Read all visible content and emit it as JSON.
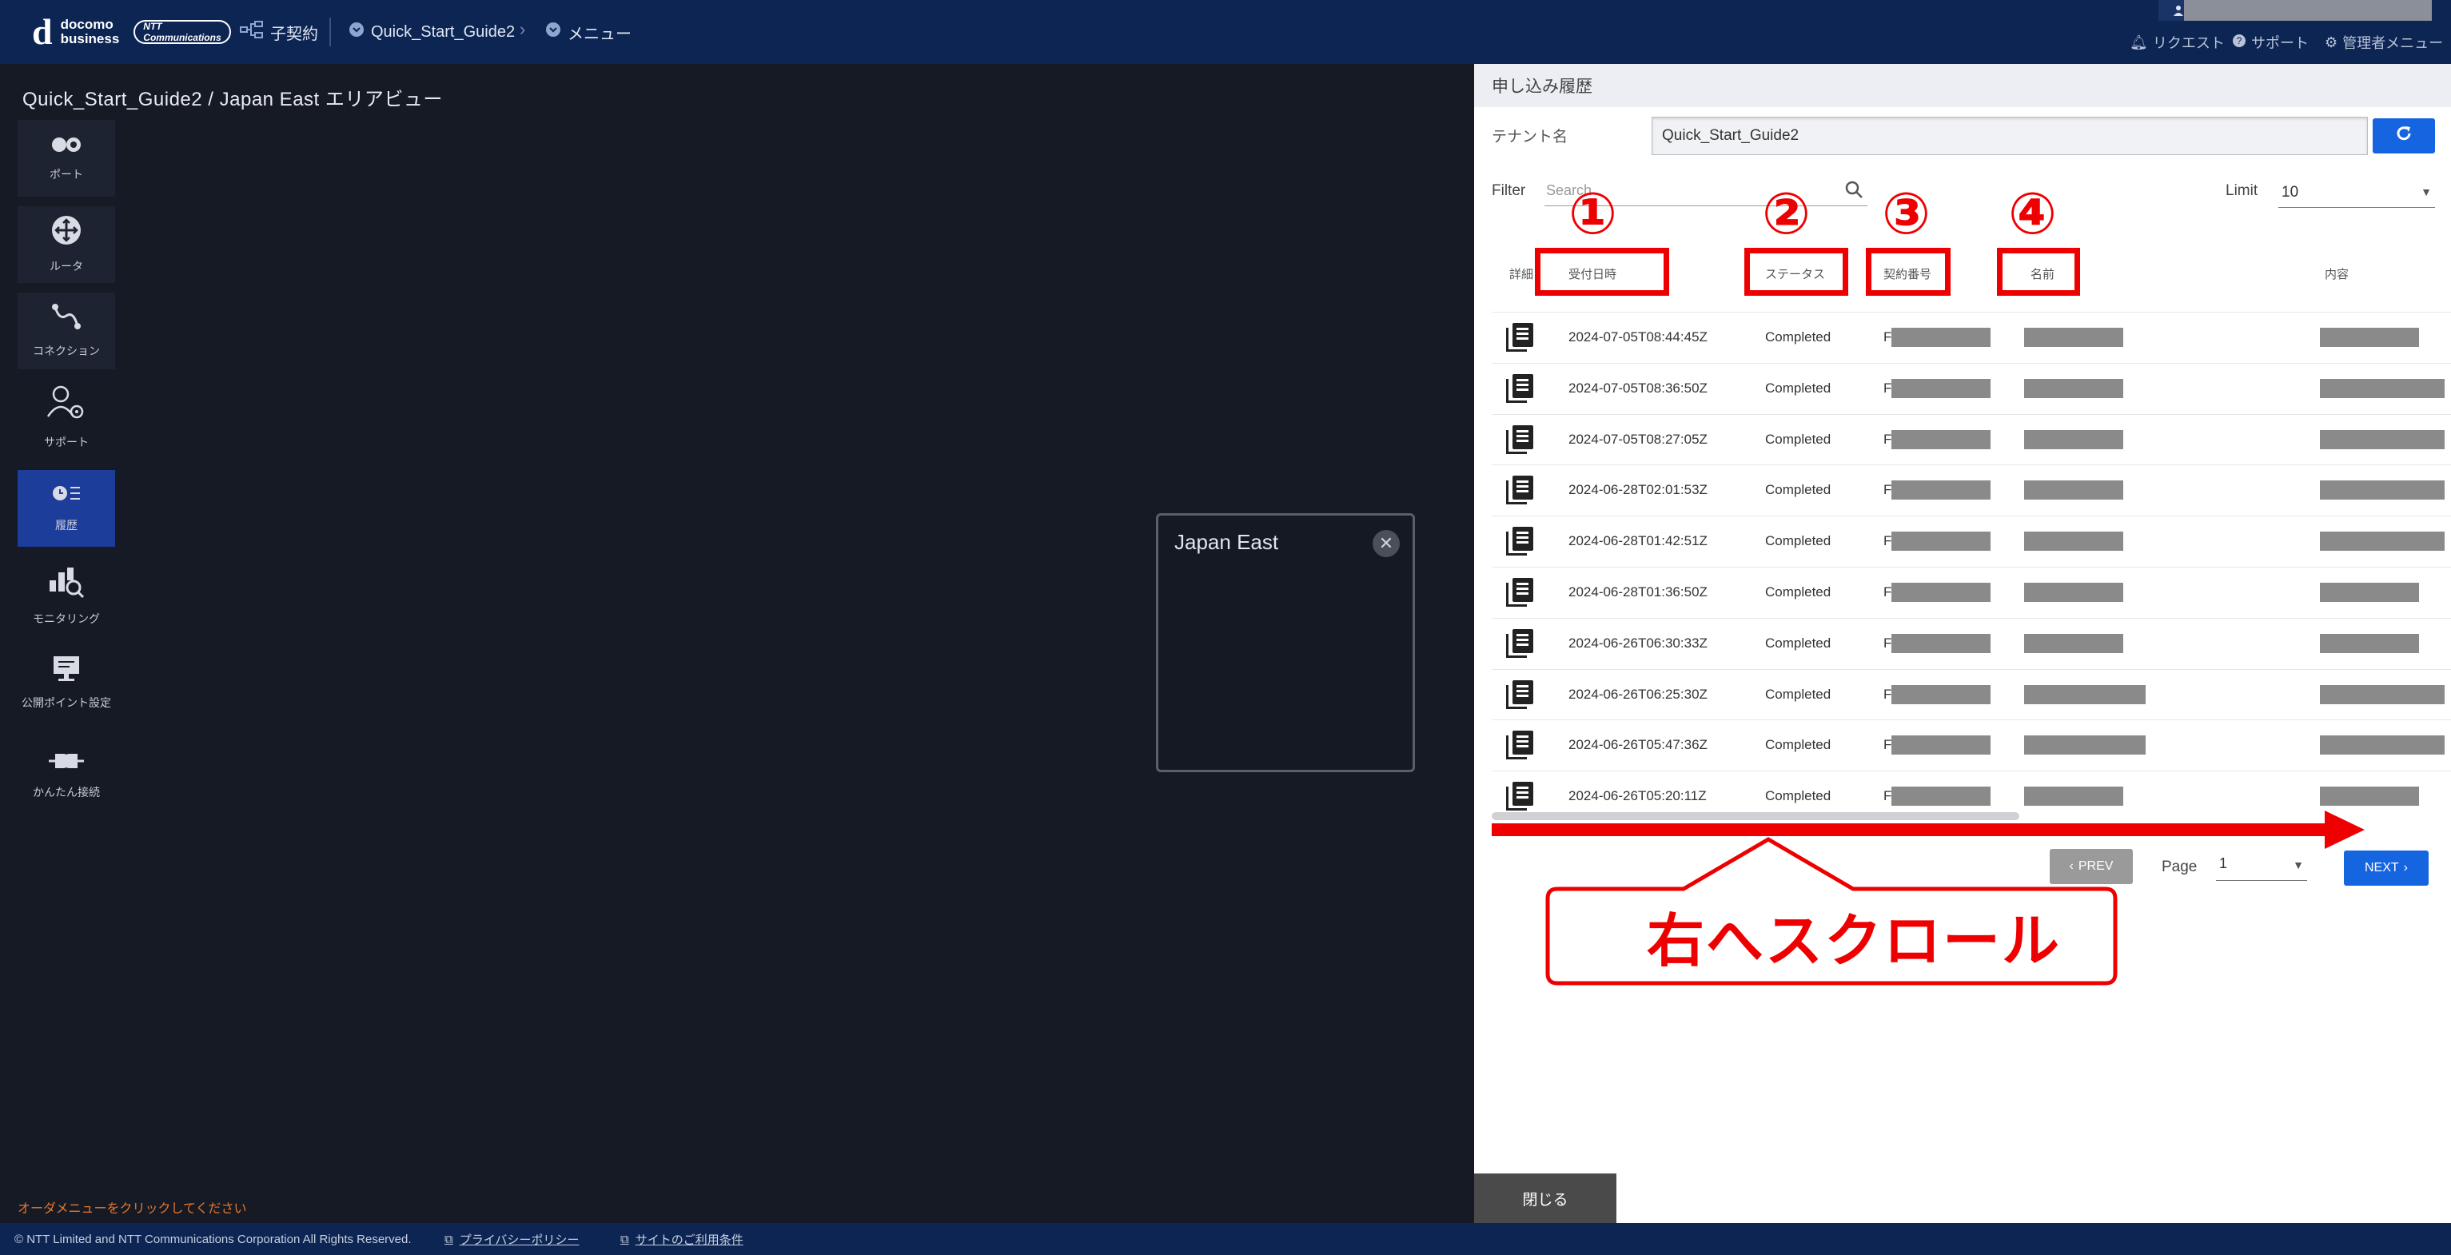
{
  "header": {
    "logo_line1": "docomo",
    "logo_line2": "business",
    "logo_ntt": "NTT Communications",
    "contract_label": "子契約",
    "breadcrumb_1": "Quick_Start_Guide2",
    "breadcrumb_2": "メニュー",
    "request": "リクエスト",
    "support": "サポート",
    "admin_menu": "管理者メニュー"
  },
  "page": {
    "title": "Quick_Start_Guide2 / Japan East エリアビュー",
    "order_hint": "オーダメニューをクリックしてください"
  },
  "sidebar": {
    "items": [
      {
        "label": "ポート",
        "icon": "port-icon"
      },
      {
        "label": "ルータ",
        "icon": "router-icon"
      },
      {
        "label": "コネクション",
        "icon": "connection-icon"
      },
      {
        "label": "サポート",
        "icon": "support-icon"
      },
      {
        "label": "履歴",
        "icon": "history-icon",
        "active": true
      },
      {
        "label": "モニタリング",
        "icon": "monitoring-icon"
      },
      {
        "label": "公開ポイント設定",
        "icon": "public-point-icon"
      },
      {
        "label": "かんたん接続",
        "icon": "easy-connect-icon"
      }
    ]
  },
  "area_popup": {
    "title": "Japan East"
  },
  "panel": {
    "title": "申し込み履歴",
    "tenant_label": "テナント名",
    "tenant_value": "Quick_Start_Guide2",
    "filter_label": "Filter",
    "search_placeholder": "Search",
    "limit_label": "Limit",
    "limit_value": "10",
    "columns": [
      "詳細",
      "受付日時",
      "ステータス",
      "契約番号",
      "名前",
      "内容"
    ],
    "contract_prefix": "F",
    "rows": [
      {
        "date": "2024-07-05T08:44:45Z",
        "status": "Completed"
      },
      {
        "date": "2024-07-05T08:36:50Z",
        "status": "Completed"
      },
      {
        "date": "2024-07-05T08:27:05Z",
        "status": "Completed"
      },
      {
        "date": "2024-06-28T02:01:53Z",
        "status": "Completed"
      },
      {
        "date": "2024-06-28T01:42:51Z",
        "status": "Completed"
      },
      {
        "date": "2024-06-28T01:36:50Z",
        "status": "Completed"
      },
      {
        "date": "2024-06-26T06:30:33Z",
        "status": "Completed"
      },
      {
        "date": "2024-06-26T06:25:30Z",
        "status": "Completed"
      },
      {
        "date": "2024-06-26T05:47:36Z",
        "status": "Completed"
      },
      {
        "date": "2024-06-26T05:20:11Z",
        "status": "Completed"
      }
    ],
    "prev_label": "PREV",
    "page_label": "Page",
    "page_value": "1",
    "next_label": "NEXT",
    "close_label": "閉じる"
  },
  "annotations": {
    "num_1": "①",
    "num_2": "②",
    "num_3": "③",
    "num_4": "④",
    "scroll_callout": "右へスクロール",
    "highlight_color": "#ee0000"
  },
  "footer": {
    "copyright": "© NTT Limited and NTT Communications Corporation All Rights Reserved.",
    "privacy": "プライバシーポリシー",
    "terms": "サイトのご利用条件"
  }
}
